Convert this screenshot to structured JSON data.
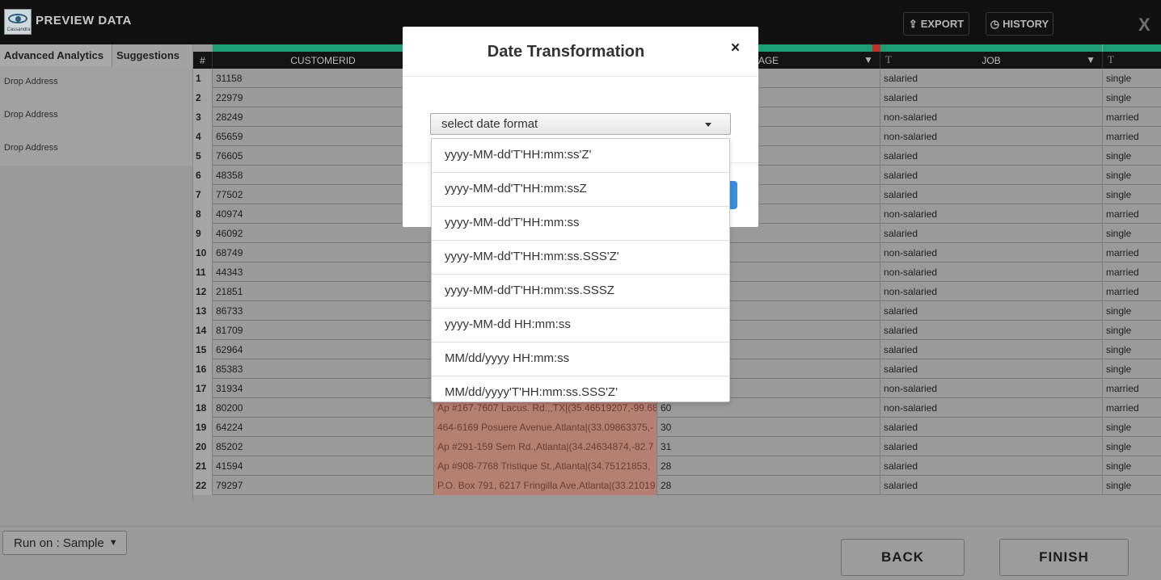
{
  "topbar": {
    "logo_text": "Cassandra",
    "title": "PREVIEW DATA",
    "export_label": "EXPORT",
    "history_label": "HISTORY",
    "close_label": "X"
  },
  "left_panel": {
    "tabs": [
      {
        "label": "Advanced Analytics"
      },
      {
        "label": "Suggestions"
      }
    ],
    "suggestions": [
      {
        "label": "Drop Address"
      },
      {
        "label": "Drop Address"
      },
      {
        "label": "Drop Address"
      }
    ]
  },
  "grid": {
    "quality_bar_colors": {
      "good": "#1e9e74",
      "bad": "#c0302a"
    },
    "headers": {
      "index": "#",
      "customerid": "CUSTOMERID",
      "age": "AGE",
      "job": "JOB",
      "type_icon": "T"
    },
    "rows": [
      {
        "n": "1",
        "customerid": "31158",
        "address": "",
        "age": "",
        "job": "salaried",
        "marital": "single"
      },
      {
        "n": "2",
        "customerid": "22979",
        "address": "",
        "age": "",
        "job": "salaried",
        "marital": "single"
      },
      {
        "n": "3",
        "customerid": "28249",
        "address": "",
        "age": "",
        "job": "non-salaried",
        "marital": "married"
      },
      {
        "n": "4",
        "customerid": "65659",
        "address": "",
        "age": "",
        "job": "non-salaried",
        "marital": "married"
      },
      {
        "n": "5",
        "customerid": "76605",
        "address": "",
        "age": "",
        "job": "salaried",
        "marital": "single"
      },
      {
        "n": "6",
        "customerid": "48358",
        "address": "",
        "age": "",
        "job": "salaried",
        "marital": "single"
      },
      {
        "n": "7",
        "customerid": "77502",
        "address": "",
        "age": "",
        "job": "salaried",
        "marital": "single"
      },
      {
        "n": "8",
        "customerid": "40974",
        "address": "",
        "age": "",
        "job": "non-salaried",
        "marital": "married"
      },
      {
        "n": "9",
        "customerid": "46092",
        "address": "",
        "age": "",
        "job": "salaried",
        "marital": "single"
      },
      {
        "n": "10",
        "customerid": "68749",
        "address": "",
        "age": "",
        "job": "non-salaried",
        "marital": "married"
      },
      {
        "n": "11",
        "customerid": "44343",
        "address": "",
        "age": "",
        "job": "non-salaried",
        "marital": "married"
      },
      {
        "n": "12",
        "customerid": "21851",
        "address": "",
        "age": "",
        "job": "non-salaried",
        "marital": "married"
      },
      {
        "n": "13",
        "customerid": "86733",
        "address": "",
        "age": "",
        "job": "salaried",
        "marital": "single"
      },
      {
        "n": "14",
        "customerid": "81709",
        "address": "",
        "age": "",
        "job": "salaried",
        "marital": "single"
      },
      {
        "n": "15",
        "customerid": "62964",
        "address": "",
        "age": "",
        "job": "salaried",
        "marital": "single"
      },
      {
        "n": "16",
        "customerid": "85383",
        "address": "",
        "age": "",
        "job": "salaried",
        "marital": "single"
      },
      {
        "n": "17",
        "customerid": "31934",
        "address": "",
        "age": "",
        "job": "non-salaried",
        "marital": "married"
      },
      {
        "n": "18",
        "customerid": "80200",
        "address": "Ap #167-7607 Lacus. Rd.,,TX|(35.46519207,-99.68",
        "age": "60",
        "job": "non-salaried",
        "marital": "married"
      },
      {
        "n": "19",
        "customerid": "64224",
        "address": "464-6169 Posuere Avenue,Atlanta|(33.09863375,-",
        "age": "30",
        "job": "salaried",
        "marital": "single"
      },
      {
        "n": "20",
        "customerid": "85202",
        "address": "Ap #291-159 Sem Rd.,Atlanta|(34.24634874,-82.7",
        "age": "31",
        "job": "salaried",
        "marital": "single"
      },
      {
        "n": "21",
        "customerid": "41594",
        "address": "Ap #908-7768 Tristique St.,Atlanta|(34.75121853,",
        "age": "28",
        "job": "salaried",
        "marital": "single"
      },
      {
        "n": "22",
        "customerid": "79297",
        "address": "P.O. Box 791, 6217 Fringilla Ave,Atlanta|(33.21019",
        "age": "28",
        "job": "salaried",
        "marital": "single"
      }
    ]
  },
  "bottom": {
    "run_on_label": "Run on : Sample",
    "back_label": "BACK",
    "finish_label": "FINISH"
  },
  "modal": {
    "title": "Date Transformation",
    "close_label": "×",
    "select_placeholder": "select date format",
    "options": [
      "yyyy-MM-dd'T'HH:mm:ss'Z'",
      "yyyy-MM-dd'T'HH:mm:ssZ",
      "yyyy-MM-dd'T'HH:mm:ss",
      "yyyy-MM-dd'T'HH:mm:ss.SSS'Z'",
      "yyyy-MM-dd'T'HH:mm:ss.SSSZ",
      "yyyy-MM-dd HH:mm:ss",
      "MM/dd/yyyy HH:mm:ss",
      "MM/dd/yyyy'T'HH:mm:ss.SSS'Z'"
    ]
  }
}
